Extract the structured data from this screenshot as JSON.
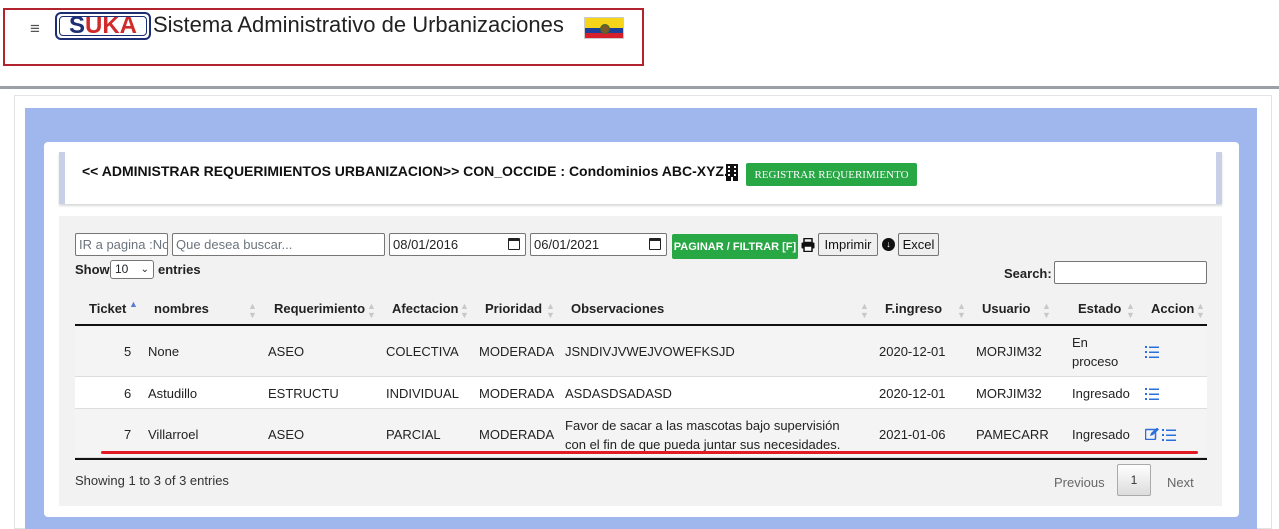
{
  "header": {
    "menu_icon": "hamburger-icon",
    "logo_text_s": "S",
    "logo_text_uka": "UKA",
    "title": "Sistema Administrativo de Urbanizaciones",
    "flag_icon": "ecuador-flag-icon"
  },
  "page": {
    "heading": "<< ADMINISTRAR REQUERIMIENTOS URBANIZACION>> CON_OCCIDE : Condominios ABC-XYZ.",
    "building_icon": "building-icon",
    "register_button": "REGISTRAR REQUERIMIENTO"
  },
  "toolbar": {
    "page_placeholder": "IR a pagina :No",
    "search_placeholder": "Que desea buscar...",
    "date_from": "08/01/2016",
    "date_to": "06/01/2021",
    "filter_button": "PAGINAR / FILTRAR [F]",
    "print_button": "Imprimir",
    "excel_button": "Excel"
  },
  "datatable": {
    "show_label": "Show",
    "page_size": "10",
    "entries_label": "entries",
    "search_label": "Search:",
    "columns": [
      "Ticket",
      "nombres",
      "Requerimiento",
      "Afectacion",
      "Prioridad",
      "Observaciones",
      "F.ingreso",
      "Usuario",
      "Estado",
      "Accion"
    ],
    "rows": [
      {
        "ticket": "5",
        "nombres": "None",
        "requerimiento": "ASEO",
        "afectacion": "COLECTIVA",
        "prioridad": "MODERADA",
        "observaciones": "JSNDIVJVWEJVOWEFKSJD",
        "fingreso": "2020-12-01",
        "usuario": "MORJIM32",
        "estado": "En proceso"
      },
      {
        "ticket": "6",
        "nombres": "Astudillo",
        "requerimiento": "ESTRUCTU",
        "afectacion": "INDIVIDUAL",
        "prioridad": "MODERADA",
        "observaciones": "ASDASDSADASD",
        "fingreso": "2020-12-01",
        "usuario": "MORJIM32",
        "estado": "Ingresado"
      },
      {
        "ticket": "7",
        "nombres": "Villarroel",
        "requerimiento": "ASEO",
        "afectacion": "PARCIAL",
        "prioridad": "MODERADA",
        "observaciones": "Favor de sacar a las mascotas bajo supervisión con el fin de que pueda juntar sus necesidades.",
        "fingreso": "2021-01-06",
        "usuario": "PAMECARR",
        "estado": "Ingresado"
      }
    ],
    "info": "Showing 1 to 3 of 3 entries",
    "previous": "Previous",
    "current_page": "1",
    "next": "Next"
  },
  "colors": {
    "accent_green": "#28a745",
    "panel_blue": "#9fb7ec",
    "highlight_red": "#e01b24",
    "icon_blue": "#2a6fdb"
  }
}
